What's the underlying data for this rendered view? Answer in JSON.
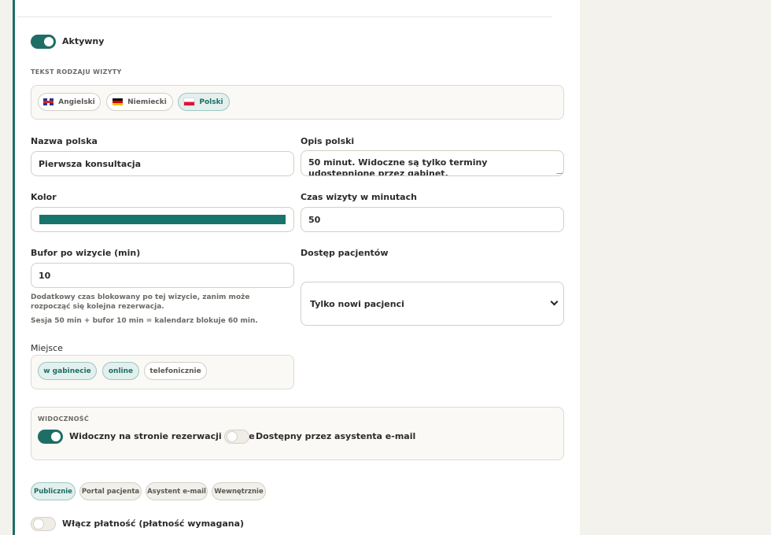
{
  "status": {
    "active_label": "Aktywny",
    "active_on": true
  },
  "text_section": {
    "caption": "TEKST RODZAJU WIZYTY",
    "languages": [
      {
        "label": "Angielski",
        "flag": "gb-flag-icon",
        "active": false
      },
      {
        "label": "Niemiecki",
        "flag": "de-flag-icon",
        "active": false
      },
      {
        "label": "Polski",
        "flag": "pl-flag-icon",
        "active": true
      }
    ]
  },
  "fields": {
    "name": {
      "label": "Nazwa polska",
      "value": "Pierwsza konsultacja"
    },
    "description": {
      "label": "Opis polski",
      "value": "50 minut. Widoczne są tylko terminy udostępnione przez gabinet."
    },
    "color": {
      "label": "Kolor",
      "value": "#17756b"
    },
    "duration": {
      "label": "Czas wizyty w minutach",
      "value": "50"
    },
    "buffer": {
      "label": "Bufor po wizycie (min)",
      "value": "10",
      "help": "Dodatkowy czas blokowany po tej wizycie, zanim może rozpocząć się kolejna rezerwacja.",
      "summary": "Sesja 50 min + bufor 10 min = kalendarz blokuje 60 min."
    },
    "patient_access": {
      "label": "Dostęp pacjentów",
      "value": "Tylko nowi pacjenci"
    }
  },
  "location": {
    "label": "Miejsce",
    "options": [
      {
        "label": "w gabinecie",
        "active": true
      },
      {
        "label": "online",
        "active": true
      },
      {
        "label": "telefonicznie",
        "active": false
      }
    ]
  },
  "visibility": {
    "caption": "WIDOCZNOŚĆ",
    "booking_label": "Widoczny na stronie rezerwacji online",
    "booking_on": true,
    "assistant_label": "Dostępny przez asystenta e-mail",
    "assistant_on": false
  },
  "audience_tabs": [
    {
      "label": "Publicznie",
      "active": true
    },
    {
      "label": "Portal pacjenta",
      "active": false
    },
    {
      "label": "Asystent e-mail",
      "active": false
    },
    {
      "label": "Wewnętrznie",
      "active": false
    }
  ],
  "payment": {
    "label": "Włącz płatność (płatność wymagana)",
    "on": false
  },
  "colors": {
    "accent": "#1e6e65",
    "page_bg": "#f4f2ed"
  }
}
